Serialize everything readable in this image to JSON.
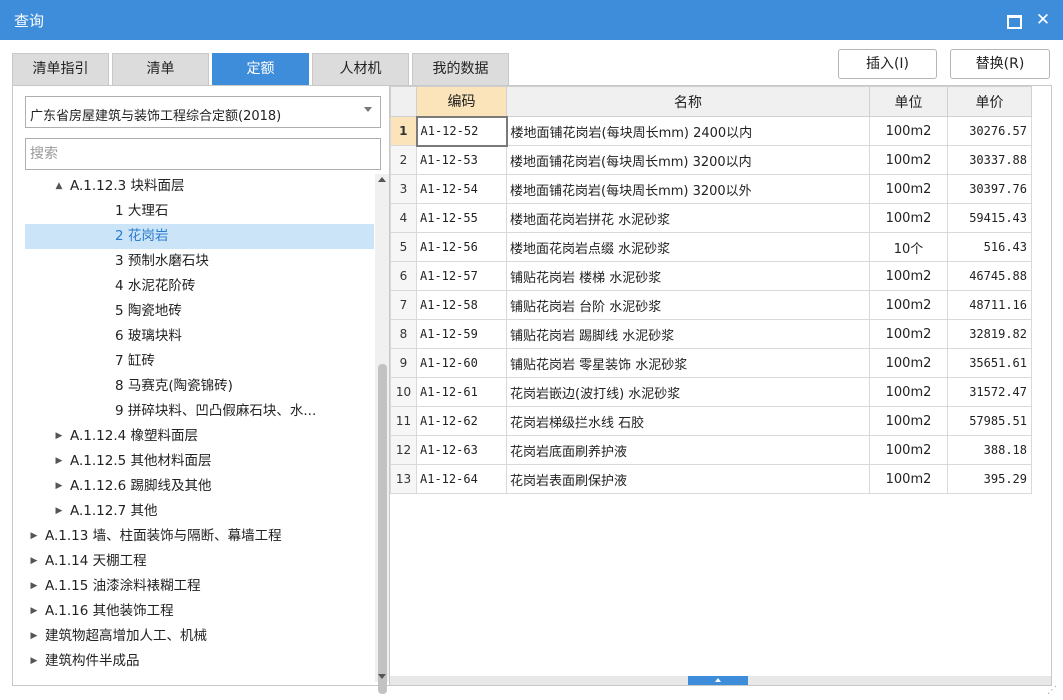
{
  "window": {
    "title": "查询"
  },
  "tabs": [
    {
      "label": "清单指引",
      "active": false
    },
    {
      "label": "清单",
      "active": false
    },
    {
      "label": "定额",
      "active": true
    },
    {
      "label": "人材机",
      "active": false
    },
    {
      "label": "我的数据",
      "active": false
    }
  ],
  "actions": {
    "insert": "插入(I)",
    "replace": "替换(R)"
  },
  "library": {
    "selected": "广东省房屋建筑与装饰工程综合定额(2018)"
  },
  "search": {
    "placeholder": "搜索"
  },
  "tree": [
    {
      "label": "A.1.12.3 块料面层",
      "arrow": "▲",
      "level": 2,
      "selected": false
    },
    {
      "label": "1 大理石",
      "arrow": "",
      "level": 3,
      "selected": false
    },
    {
      "label": "2 花岗岩",
      "arrow": "",
      "level": 3,
      "selected": true
    },
    {
      "label": "3 预制水磨石块",
      "arrow": "",
      "level": 3,
      "selected": false
    },
    {
      "label": "4 水泥花阶砖",
      "arrow": "",
      "level": 3,
      "selected": false
    },
    {
      "label": "5 陶瓷地砖",
      "arrow": "",
      "level": 3,
      "selected": false
    },
    {
      "label": "6 玻璃块料",
      "arrow": "",
      "level": 3,
      "selected": false
    },
    {
      "label": "7 缸砖",
      "arrow": "",
      "level": 3,
      "selected": false
    },
    {
      "label": "8 马赛克(陶瓷锦砖)",
      "arrow": "",
      "level": 3,
      "selected": false
    },
    {
      "label": "9 拼碎块料、凹凸假麻石块、水...",
      "arrow": "",
      "level": 3,
      "selected": false
    },
    {
      "label": "A.1.12.4 橡塑料面层",
      "arrow": "▶",
      "level": 2,
      "selected": false
    },
    {
      "label": "A.1.12.5 其他材料面层",
      "arrow": "▶",
      "level": 2,
      "selected": false
    },
    {
      "label": "A.1.12.6 踢脚线及其他",
      "arrow": "▶",
      "level": 2,
      "selected": false
    },
    {
      "label": "A.1.12.7 其他",
      "arrow": "▶",
      "level": 2,
      "selected": false
    },
    {
      "label": "A.1.13 墙、柱面装饰与隔断、幕墙工程",
      "arrow": "▶",
      "level": 1,
      "selected": false
    },
    {
      "label": "A.1.14 天棚工程",
      "arrow": "▶",
      "level": 1,
      "selected": false
    },
    {
      "label": "A.1.15 油漆涂料裱糊工程",
      "arrow": "▶",
      "level": 1,
      "selected": false
    },
    {
      "label": "A.1.16 其他装饰工程",
      "arrow": "▶",
      "level": 1,
      "selected": false
    },
    {
      "label": "建筑物超高增加人工、机械",
      "arrow": "▶",
      "level": 1,
      "selected": false
    },
    {
      "label": "建筑构件半成品",
      "arrow": "▶",
      "level": 1,
      "selected": false
    }
  ],
  "table": {
    "columns": [
      "编码",
      "名称",
      "单位",
      "单价"
    ],
    "rows": [
      {
        "no": "1",
        "code": "A1-12-52",
        "name": "楼地面铺花岗岩(每块周长mm) 2400以内",
        "unit": "100m2",
        "price": "30276.57"
      },
      {
        "no": "2",
        "code": "A1-12-53",
        "name": "楼地面铺花岗岩(每块周长mm) 3200以内",
        "unit": "100m2",
        "price": "30337.88"
      },
      {
        "no": "3",
        "code": "A1-12-54",
        "name": "楼地面铺花岗岩(每块周长mm) 3200以外",
        "unit": "100m2",
        "price": "30397.76"
      },
      {
        "no": "4",
        "code": "A1-12-55",
        "name": "楼地面花岗岩拼花 水泥砂浆",
        "unit": "100m2",
        "price": "59415.43"
      },
      {
        "no": "5",
        "code": "A1-12-56",
        "name": "楼地面花岗岩点缀 水泥砂浆",
        "unit": "10个",
        "price": "516.43"
      },
      {
        "no": "6",
        "code": "A1-12-57",
        "name": "铺贴花岗岩 楼梯 水泥砂浆",
        "unit": "100m2",
        "price": "46745.88"
      },
      {
        "no": "7",
        "code": "A1-12-58",
        "name": "铺贴花岗岩 台阶 水泥砂浆",
        "unit": "100m2",
        "price": "48711.16"
      },
      {
        "no": "8",
        "code": "A1-12-59",
        "name": "铺贴花岗岩 踢脚线 水泥砂浆",
        "unit": "100m2",
        "price": "32819.82"
      },
      {
        "no": "9",
        "code": "A1-12-60",
        "name": "铺贴花岗岩 零星装饰 水泥砂浆",
        "unit": "100m2",
        "price": "35651.61"
      },
      {
        "no": "10",
        "code": "A1-12-61",
        "name": "花岗岩嵌边(波打线) 水泥砂浆",
        "unit": "100m2",
        "price": "31572.47"
      },
      {
        "no": "11",
        "code": "A1-12-62",
        "name": "花岗岩梯级拦水线 石胶",
        "unit": "100m2",
        "price": "57985.51"
      },
      {
        "no": "12",
        "code": "A1-12-63",
        "name": "花岗岩底面刷养护液",
        "unit": "100m2",
        "price": "388.18"
      },
      {
        "no": "13",
        "code": "A1-12-64",
        "name": "花岗岩表面刷保护液",
        "unit": "100m2",
        "price": "395.29"
      }
    ]
  },
  "colors": {
    "accent": "#3d8ddb",
    "header_highlight": "#fbe4ba",
    "selected_row": "#cce4f7"
  },
  "icons": {
    "maximize": "maximize-icon",
    "close": "close-icon"
  }
}
